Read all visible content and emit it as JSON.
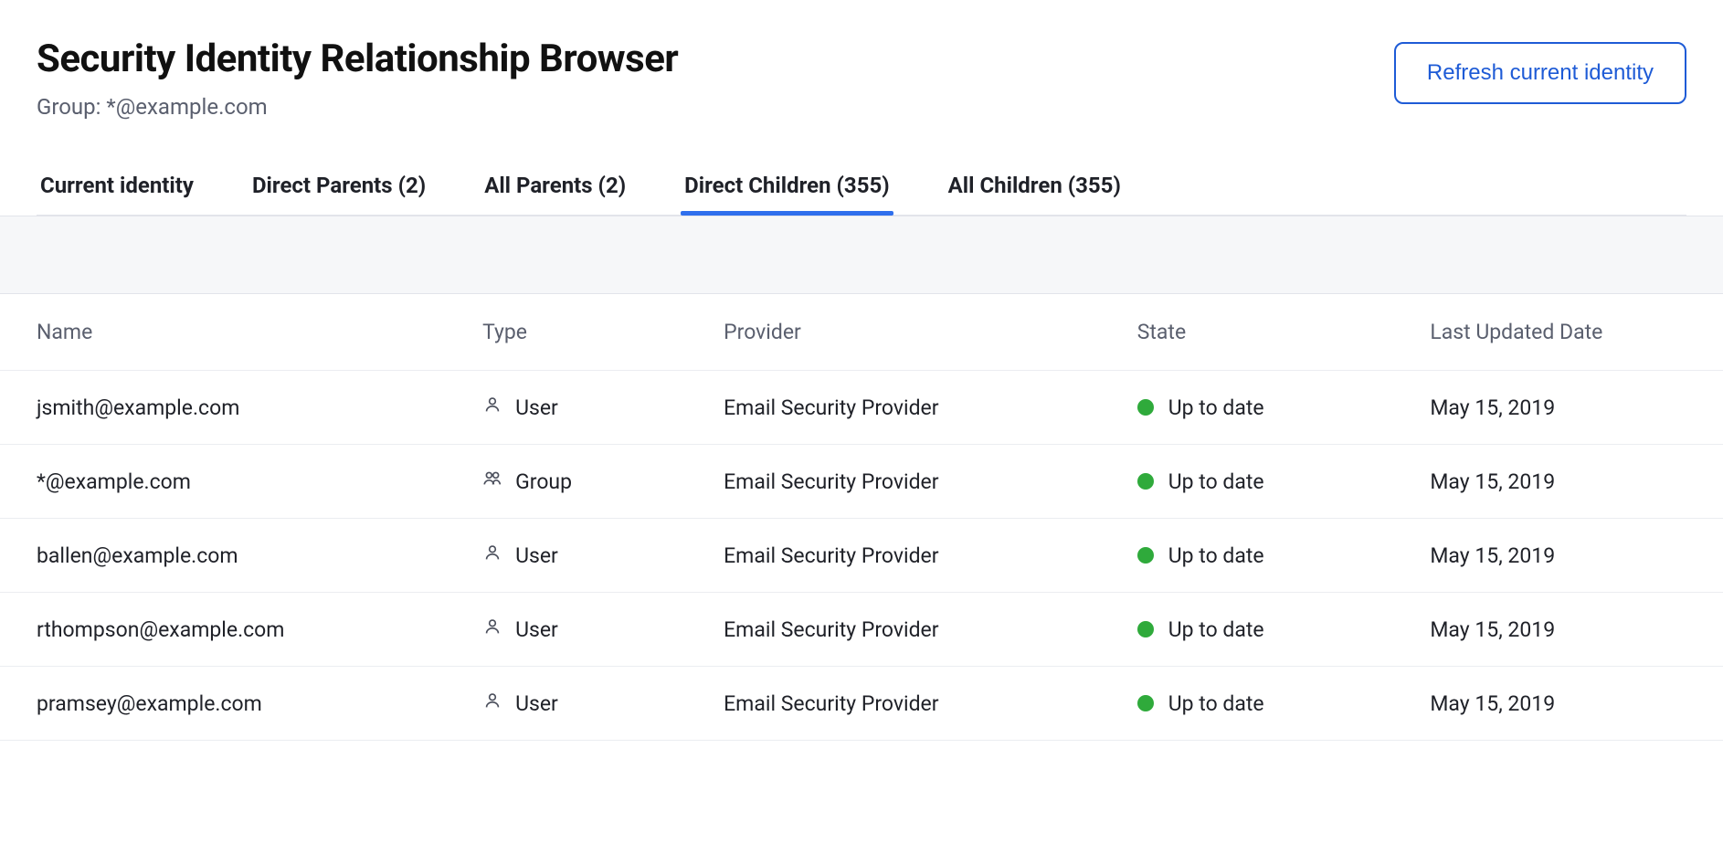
{
  "header": {
    "title": "Security Identity Relationship Browser",
    "subtitle": "Group: *@example.com",
    "refresh_label": "Refresh current identity"
  },
  "tabs": [
    {
      "label": "Current identity",
      "active": false
    },
    {
      "label": "Direct Parents (2)",
      "active": false
    },
    {
      "label": "All Parents (2)",
      "active": false
    },
    {
      "label": "Direct Children (355)",
      "active": true
    },
    {
      "label": "All Children (355)",
      "active": false
    }
  ],
  "table": {
    "columns": {
      "name": "Name",
      "type": "Type",
      "provider": "Provider",
      "state": "State",
      "last_updated": "Last Updated Date"
    },
    "rows": [
      {
        "name": "jsmith@example.com",
        "type": "User",
        "provider": "Email Security Provider",
        "state": "Up to date",
        "last_updated": "May 15, 2019"
      },
      {
        "name": "*@example.com",
        "type": "Group",
        "provider": "Email Security Provider",
        "state": "Up to date",
        "last_updated": "May 15, 2019"
      },
      {
        "name": "ballen@example.com",
        "type": "User",
        "provider": "Email Security Provider",
        "state": "Up to date",
        "last_updated": "May 15, 2019"
      },
      {
        "name": "rthompson@example.com",
        "type": "User",
        "provider": "Email Security Provider",
        "state": "Up to date",
        "last_updated": "May 15, 2019"
      },
      {
        "name": "pramsey@example.com",
        "type": "User",
        "provider": "Email Security Provider",
        "state": "Up to date",
        "last_updated": "May 15, 2019"
      }
    ]
  },
  "colors": {
    "accent": "#2f6fed",
    "state_ok": "#2faa3b"
  }
}
